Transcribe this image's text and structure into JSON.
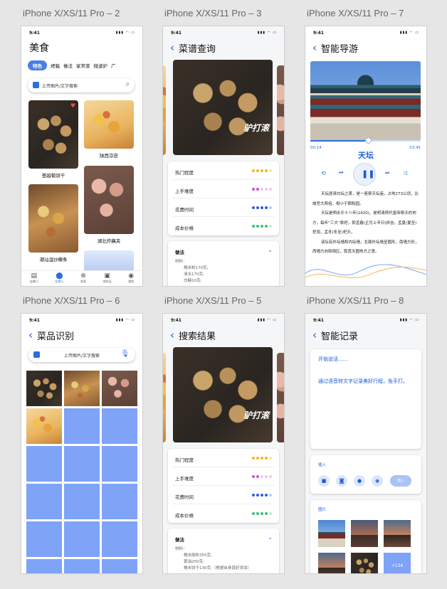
{
  "artboards": {
    "s2": "iPhone X/XS/11 Pro – 2",
    "s3": "iPhone X/XS/11 Pro – 3",
    "s7": "iPhone X/XS/11 Pro – 7",
    "s6": "iPhone X/XS/11 Pro – 6",
    "s5": "iPhone X/XS/11 Pro – 5",
    "s8": "iPhone X/XS/11 Pro – 8"
  },
  "status": {
    "time": "9:41"
  },
  "home": {
    "title": "美食",
    "tabs": [
      "特色",
      "烤箱",
      "做法",
      "家常菜",
      "微波炉",
      "广"
    ],
    "search_placeholder": "上传图片/文字搜索",
    "dishes": [
      "荟越葡饼干",
      "陕西凉皮",
      "湖北炸藕夹",
      "潮汕湿炒粿条"
    ],
    "nav": [
      "去哪儿",
      "在哪儿",
      "发表",
      "他作品",
      "我的"
    ]
  },
  "recipe": {
    "title": "菜谱查询",
    "stamp": "驴打滚",
    "rows": [
      "热门程度",
      "上手难度",
      "花费时间",
      "成本价格"
    ],
    "method": "做法",
    "materials_label": "材料：",
    "materials": [
      "糯米粉170克;",
      "清水170克;",
      "白糖10克;"
    ],
    "dot_colors": [
      "#f5b323",
      "#d14fd1",
      "#2e5be8",
      "#3cc07a"
    ]
  },
  "guide": {
    "title": "智能导游",
    "elapsed": "00:14",
    "total": "03:45",
    "place": "天坛",
    "progress": 0.52,
    "para1": "天坛居清白坛之首，是一座祭天坛庙，占地273公顷，比故宫大两倍，相小于颐和园。",
    "para2": "天坛是明永乐十八年(1420)，是明清两代皇帝祭天的地方，每年“三大”祭祀，即孟春(正月上辛日)祈谷，孟夏(夏至)祀雨，孟冬(冬至)祀天。",
    "para3": "该坛有外坛墙和内坛墙，北面外坛墙呈圆形，南墙方形，西墙方向和相区，取其天圆地方之意。"
  },
  "identify": {
    "title": "菜品识别",
    "search_placeholder": "上传图片/文字搜索"
  },
  "results": {
    "title": "搜索结果",
    "stamp": "驴打滚",
    "rows": [
      "热门程度",
      "上手难度",
      "花费时间",
      "成本价格"
    ],
    "method": "做法",
    "materials_label": "材料：",
    "materials": [
      "糯米面粉350克;",
      "黄油250克;",
      "糯米饼干130克;（根据自身喜好添加）"
    ]
  },
  "record": {
    "title": "智能记录",
    "placeholder": "开始说话......",
    "hint": "通过语音转文字记录美好行程，免手打。",
    "insert_label": "插入",
    "insert_btn": "插入",
    "photos_label": "图片",
    "more_count": "+134"
  }
}
